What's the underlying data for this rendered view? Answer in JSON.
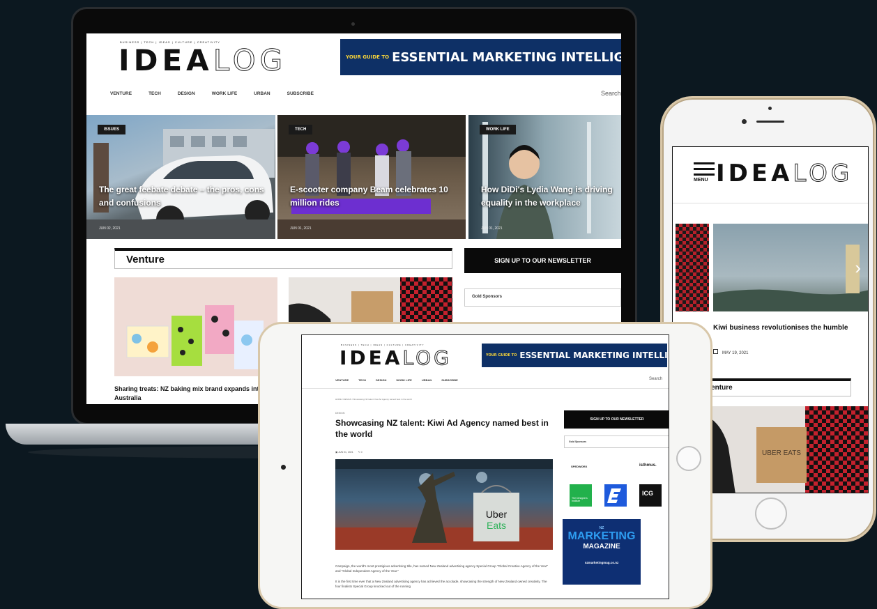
{
  "site": {
    "tagline": "BUSINESS | TECH | IDEAS | CULTURE | CREATIVITY",
    "logo_bold": "IDEA",
    "logo_light": "LOG",
    "ad_small": "YOUR GUIDE TO",
    "ad_text": "ESSENTIAL MARKETING INTELLIGENCE"
  },
  "laptop": {
    "nav": [
      "VENTURE",
      "TECH",
      "DESIGN",
      "WORK LIFE",
      "URBAN",
      "SUBSCRIBE"
    ],
    "search": "Search",
    "heroes": [
      {
        "category": "ISSUES",
        "title": "The great feebate debate – the pros, cons and confusions",
        "date": "JUN 02, 2021"
      },
      {
        "category": "TECH",
        "title": "E-scooter company Beam celebrates 10 million rides",
        "date": "JUN 01, 2021"
      },
      {
        "category": "WORK LIFE",
        "title": "How DiDi's Lydia Wang is driving equality in the workplace",
        "date": "JUN 01, 2021"
      }
    ],
    "section": "Venture",
    "newsletter": "SIGN UP TO OUR NEWSLETTER",
    "sponsors": "Gold Sponsors",
    "article_title": "Sharing treats: NZ baking mix brand expands into Australia"
  },
  "phone": {
    "menu": "MENU",
    "article_title": "Kiwi business revolutionises the humble",
    "date": "MAY 19, 2021",
    "section": "Venture",
    "bag_text": "UBER EATS"
  },
  "tablet": {
    "nav": [
      "VENTURE",
      "TECH",
      "DESIGN",
      "WORK LIFE",
      "URBAN",
      "SUBSCRIBE"
    ],
    "search": "Search",
    "breadcrumb": "HOME / DESIGN / Showcasing NZ talent: Kiwi Ad Agency named best in the world",
    "category": "DESIGN",
    "title": "Showcasing NZ talent: Kiwi Ad Agency named best in the world",
    "meta_date": "JUN 01, 2021",
    "meta_comments": "0",
    "body_1": "Campaign, the world's most prestigious advertising title, has named New Zealand advertising agency Special Group \"Global Creative Agency of the Year\" and \"Global Independent Agency of the Year.\"",
    "body_2": "It is the first time ever that a New Zealand advertising agency has achieved the accolade, showcasing the strength of New Zealand owned creativity. The four finalists Special Group knocked out of the running",
    "newsletter": "SIGN UP TO OUR NEWSLETTER",
    "sponsors": "Gold Sponsors",
    "sponsor_1": "SPEDWORX",
    "sponsor_2": "isthmus.",
    "sponsor_3": "The Designers Institute",
    "sponsor_5": "ICG",
    "uber_line1": "Uber",
    "uber_line2": "Eats",
    "mag_top": "NZ",
    "mag_title": "MARKETING",
    "mag_sub": "MAGAZINE",
    "mag_url": "nzmarketingmag.co.nz"
  },
  "colors": {
    "background": "#0c1820",
    "ad_blue": "#0e3066",
    "ad_yellow": "#f6d33a",
    "uber_green": "#2fb25a",
    "mag_blue": "#0e2f73"
  }
}
